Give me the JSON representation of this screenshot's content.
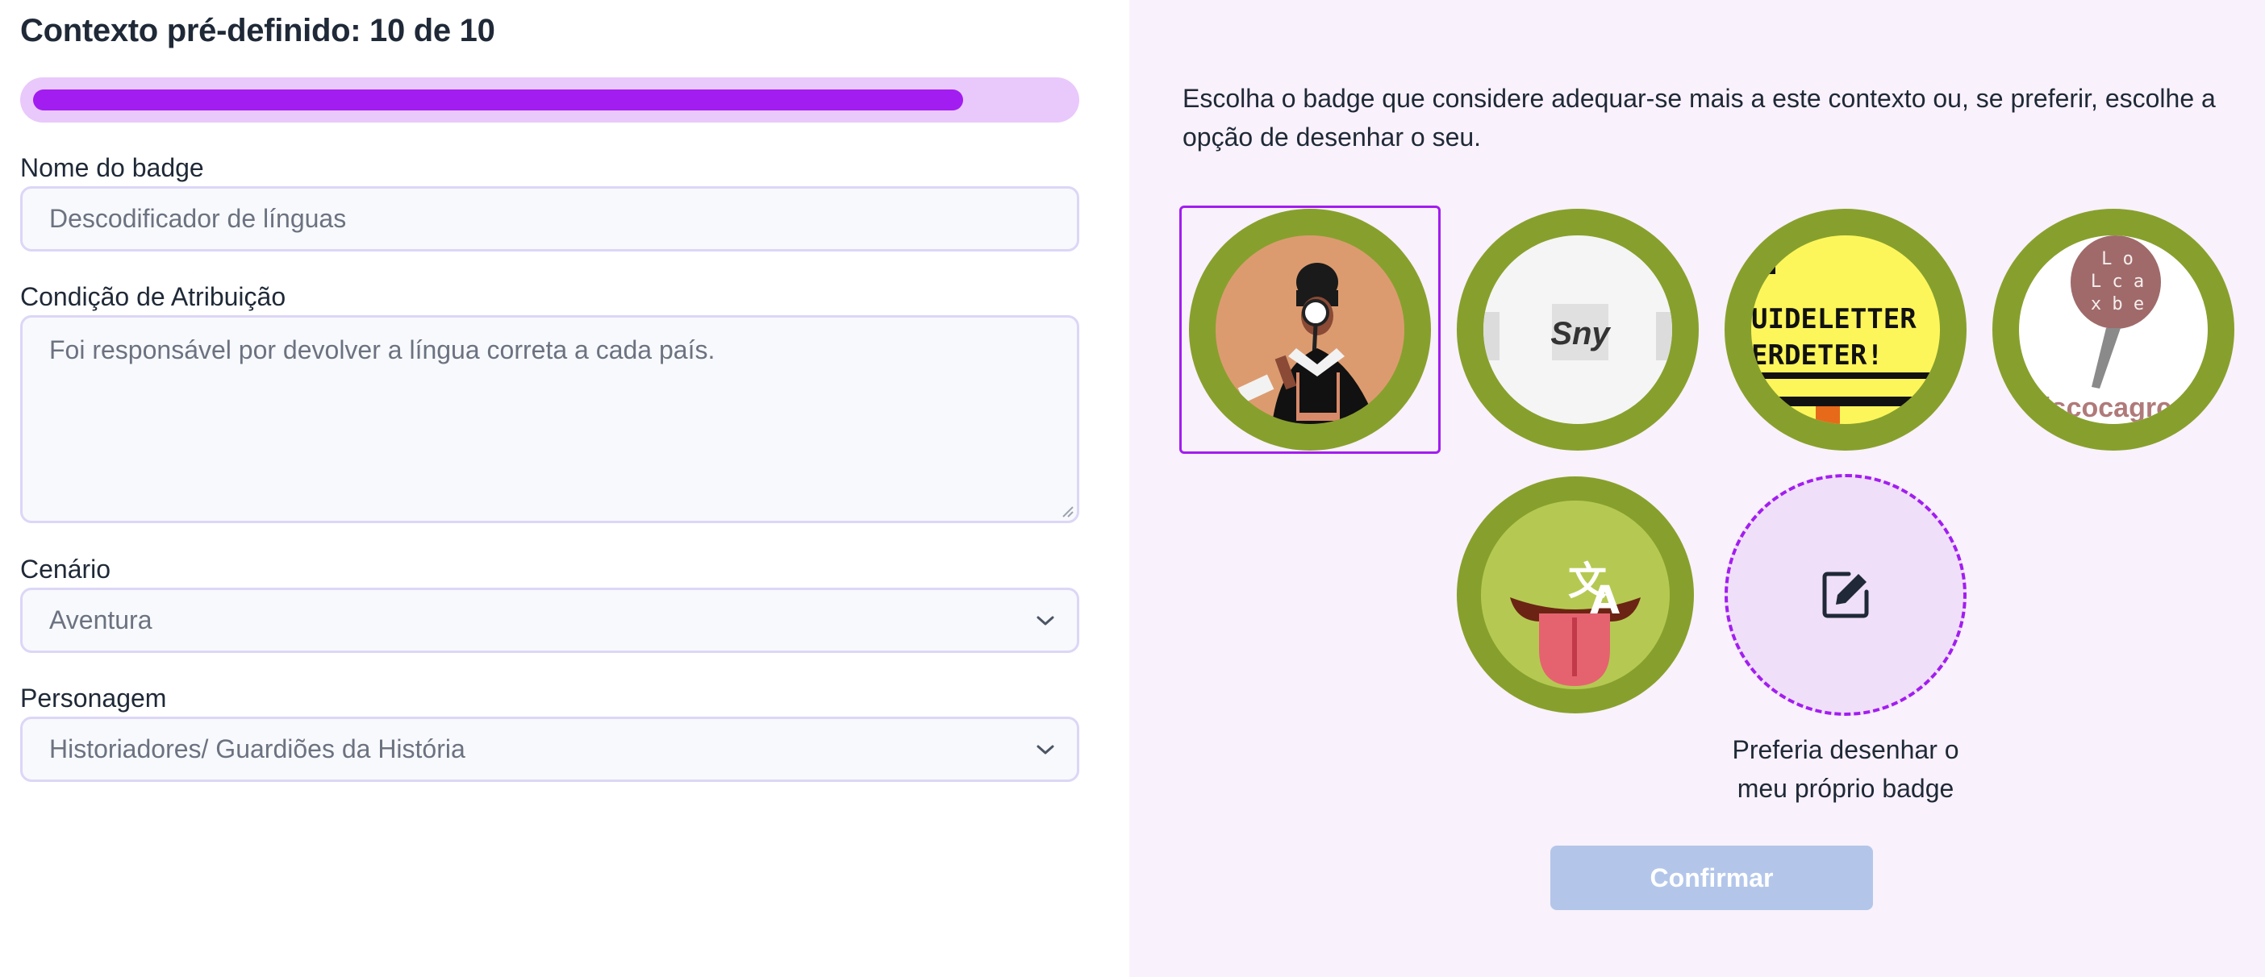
{
  "form": {
    "title": "Contexto pré-definido: 10 de 10",
    "progress_percent": 90,
    "badge_name": {
      "label": "Nome do badge",
      "placeholder": "Descodificador de línguas"
    },
    "condition": {
      "label": "Condição de Atribuição",
      "placeholder": "Foi responsável por devolver a língua correta a cada país."
    },
    "scenario": {
      "label": "Cenário",
      "value": "Aventura"
    },
    "character": {
      "label": "Personagem",
      "value": "Historiadores/ Guardiões da História"
    }
  },
  "gallery": {
    "instructions": "Escolha o badge que considere adequar-se mais a este contexto ou, se preferir, escolhe a opção de desenhar o seu.",
    "badges": [
      {
        "icon": "detective-figure-icon",
        "selected": true
      },
      {
        "icon": "sny-text-strip-icon",
        "selected": false,
        "text": "Sny"
      },
      {
        "icon": "pixel-text-icon",
        "selected": false,
        "text_lines": [
          "UIDELETTER",
          "ERDETER!"
        ]
      },
      {
        "icon": "letter-pin-icon",
        "selected": false,
        "pin_letters": [
          "L o",
          "L c a",
          "x b e"
        ],
        "text": "iscocagrco"
      },
      {
        "icon": "tongue-translate-icon",
        "selected": false
      }
    ],
    "draw_option": {
      "icon": "edit-pencil-icon",
      "caption_line1": "Preferia desenhar o",
      "caption_line2": "meu próprio badge"
    },
    "confirm_label": "Confirmar"
  },
  "colors": {
    "accent": "#a21df0",
    "progress_track": "#e9c8fb",
    "badge_ring": "#87a02d",
    "panel_bg": "#f9f1fb",
    "confirm_disabled": "#b3c6ea"
  }
}
